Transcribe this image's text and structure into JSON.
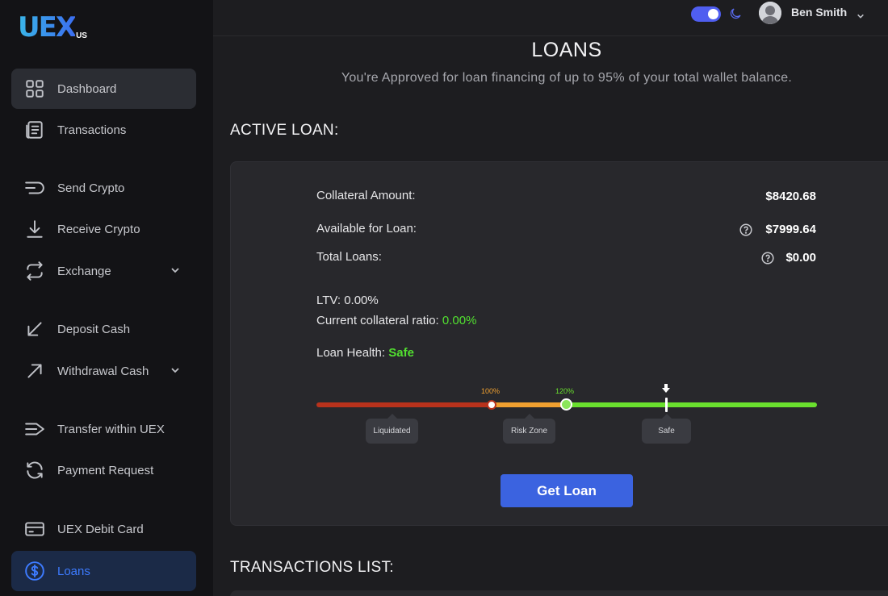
{
  "app": {
    "logo_text": "UEX",
    "logo_sub": "US",
    "brand_color": "#3b63e0"
  },
  "sidebar": {
    "items": [
      {
        "label": "Dashboard",
        "icon": "grid-icon"
      },
      {
        "label": "Transactions",
        "icon": "document-icon"
      },
      {
        "label": "Send Crypto",
        "icon": "send-icon"
      },
      {
        "label": "Receive Crypto",
        "icon": "download-icon"
      },
      {
        "label": "Exchange",
        "icon": "exchange-icon",
        "has_submenu": true
      },
      {
        "label": "Deposit Cash",
        "icon": "arrow-down-left-icon"
      },
      {
        "label": "Withdrawal Cash",
        "icon": "arrow-up-right-icon",
        "has_submenu": true
      },
      {
        "label": "Transfer within UEX",
        "icon": "transfer-icon"
      },
      {
        "label": "Payment Request",
        "icon": "refresh-icon"
      },
      {
        "label": "UEX Debit Card",
        "icon": "card-icon"
      },
      {
        "label": "Loans",
        "icon": "dollar-icon",
        "active": true
      }
    ]
  },
  "topbar": {
    "theme_toggle": "on",
    "user_name": "Ben Smith"
  },
  "main": {
    "title": "LOANS",
    "subtitle": "You're Approved for loan financing of up to 95% of your total wallet balance.",
    "active_loan_title": "ACTIVE LOAN:",
    "transactions_title": "TRANSACTIONS LIST:"
  },
  "loan": {
    "collateral_label": "Collateral Amount:",
    "collateral_value": "$8420.68",
    "available_label": "Available for Loan:",
    "available_value": "$7999.64",
    "total_label": "Total Loans:",
    "total_value": "$0.00",
    "ltv_label": "LTV:",
    "ltv_value": "0.00%",
    "ratio_label": "Current collateral ratio:",
    "ratio_value": "0.00%",
    "health_label": "Loan Health:",
    "health_value": "Safe",
    "marker_100": "100%",
    "marker_120": "120%",
    "zones": [
      "Liquidated",
      "Risk Zone",
      "Safe"
    ],
    "button_label": "Get Loan"
  },
  "colors": {
    "liquidated": "#b8321c",
    "risk": "#f0a030",
    "safe": "#6ae02e",
    "accent_green": "#52e030"
  }
}
